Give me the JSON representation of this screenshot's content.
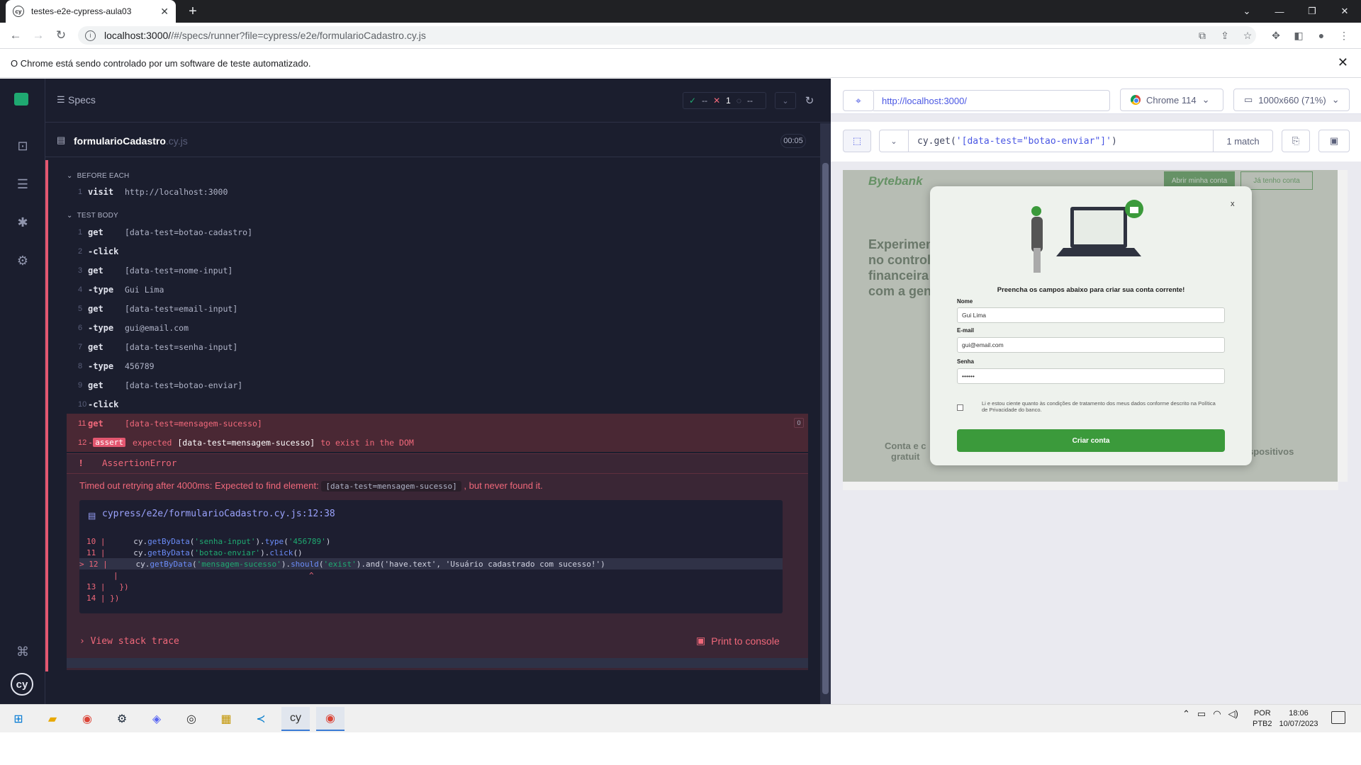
{
  "browser": {
    "tab_title": "testes-e2e-cypress-aula03",
    "tab_favicon": "cy",
    "new_tab": "+",
    "url_host": "localhost:3000/",
    "url_path": "/#/specs/runner?file=cypress/e2e/formularioCadastro.cy.js",
    "infobar_text": "O Chrome está sendo controlado por um software de teste automatizado."
  },
  "cypress": {
    "specs_label": "Specs",
    "stats": {
      "passed": "--",
      "failed": "1",
      "pending": "--"
    },
    "file_name": "formularioCadastro",
    "file_ext": ".cy.js",
    "duration": "00:05",
    "before_each_label": "BEFORE EACH",
    "test_body_label": "TEST BODY",
    "before_each_cmds": [
      {
        "n": "1",
        "name": "visit",
        "msg": "http://localhost:3000"
      }
    ],
    "cmds": [
      {
        "n": "1",
        "name": "get",
        "msg": "[data-test=botao-cadastro]"
      },
      {
        "n": "2",
        "name": "-click",
        "msg": ""
      },
      {
        "n": "3",
        "name": "get",
        "msg": "[data-test=nome-input]"
      },
      {
        "n": "4",
        "name": "-type",
        "msg": "Gui Lima"
      },
      {
        "n": "5",
        "name": "get",
        "msg": "[data-test=email-input]"
      },
      {
        "n": "6",
        "name": "-type",
        "msg": "gui@email.com"
      },
      {
        "n": "7",
        "name": "get",
        "msg": "[data-test=senha-input]"
      },
      {
        "n": "8",
        "name": "-type",
        "msg": "456789"
      },
      {
        "n": "9",
        "name": "get",
        "msg": "[data-test=botao-enviar]"
      },
      {
        "n": "10",
        "name": "-click",
        "msg": ""
      }
    ],
    "fail_cmd_11": {
      "n": "11",
      "name": "get",
      "msg": "[data-test=mensagem-sucesso]",
      "badge": "0"
    },
    "fail_cmd_12": {
      "n": "12",
      "name": "assert",
      "pre": "-",
      "msg_a": "expected",
      "msg_b": "[data-test=mensagem-sucesso]",
      "msg_c": "to exist in the DOM"
    },
    "error": {
      "icon": "!",
      "name": "AssertionError",
      "msg_pre": "Timed out retrying after 4000ms: Expected to find element:",
      "msg_code": "[data-test=mensagem-sucesso]",
      "msg_post": ", but never found it.",
      "frame_path": "cypress/e2e/formularioCadastro.cy.js:12:38",
      "code_lines": [
        {
          "ln": "10 |",
          "code_a": "      cy.",
          "fn1": "getByData",
          "p1": "(",
          "s1": "'senha-input'",
          "p2": ").",
          "fn2": "type",
          "p3": "(",
          "s2": "'456789'",
          "p4": ")"
        },
        {
          "ln": "11 |",
          "code_a": "      cy.",
          "fn1": "getByData",
          "p1": "(",
          "s1": "'botao-enviar'",
          "p2": ").",
          "fn2": "click",
          "p3": "()",
          "s2": "",
          "p4": ""
        },
        {
          "ln": "> 12 |",
          "code_a": "      cy.",
          "fn1": "getByData",
          "p1": "(",
          "s1": "'mensagem-sucesso'",
          "p2": ").",
          "fn2": "should",
          "p3": "(",
          "s2": "'exist'",
          "p4": ").and('have.text', 'Usuário cadastrado com sucesso!')"
        }
      ],
      "caret": "^",
      "line13": "13 |   })",
      "line14": "14 | })",
      "view_stack": "View stack trace",
      "print_console": "Print to console"
    }
  },
  "aut": {
    "url": "http://localhost:3000/",
    "browser": "Chrome 114",
    "viewport": "1000x660 (71%)",
    "selector_pre": "cy.get(",
    "selector_str": "'[data-test=\"botao-enviar\"]'",
    "selector_post": ")",
    "match": "1 match"
  },
  "app": {
    "logo": "Bytebank",
    "btn_open": "Abrir minha conta",
    "btn_have": "Já tenho conta",
    "hero": "Experimente\nno controle\nfinanceira\ncom a gen",
    "feature1": "Conta e c\ngratuit",
    "feature2": "Dispositivos",
    "modal": {
      "close": "x",
      "title": "Preencha os campos abaixo para criar sua conta corrente!",
      "name_label": "Nome",
      "name_value": "Gui Lima",
      "email_label": "E-mail",
      "email_value": "gui@email.com",
      "pass_label": "Senha",
      "pass_value": "••••••",
      "terms": "Li e estou ciente quanto às condições de tratamento dos meus dados conforme descrito na Política de Privacidade do banco.",
      "submit": "Criar conta"
    }
  },
  "taskbar": {
    "lang1": "POR",
    "lang2": "PTB2",
    "time": "18:06",
    "date": "10/07/2023"
  }
}
